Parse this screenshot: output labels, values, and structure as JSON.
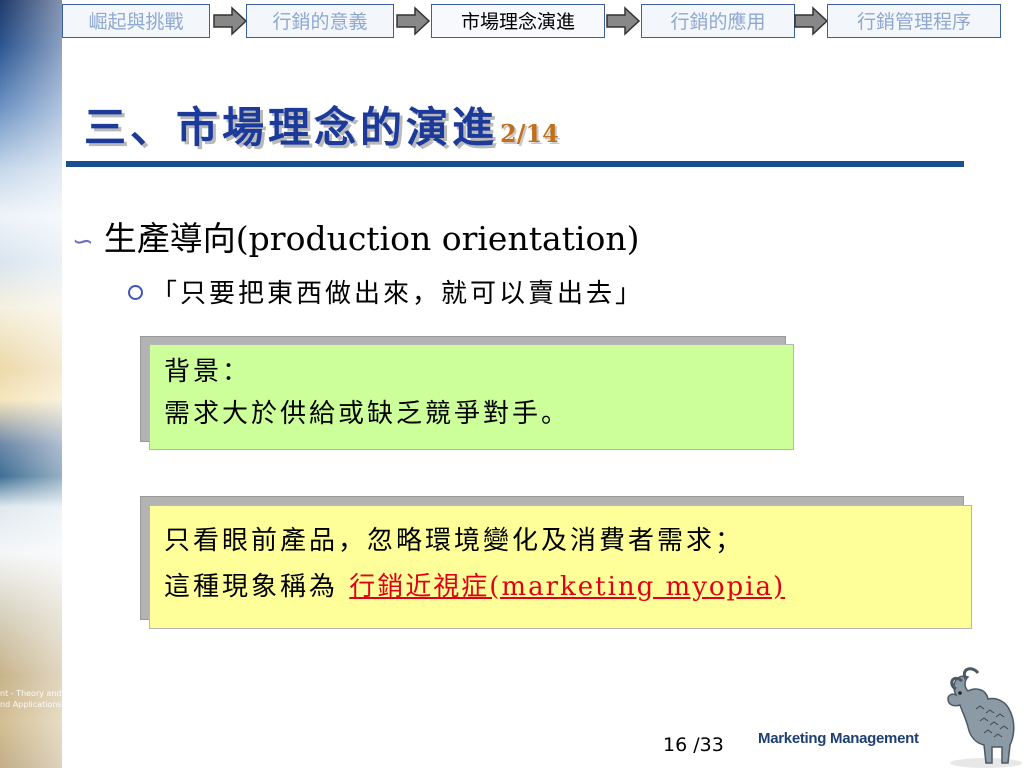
{
  "nav": {
    "items": [
      {
        "label": "崛起與挑戰",
        "active": false
      },
      {
        "label": "行銷的意義",
        "active": false
      },
      {
        "label": "市場理念演進",
        "active": true
      },
      {
        "label": "行銷的應用",
        "active": false
      },
      {
        "label": "行銷管理程序",
        "active": false
      }
    ]
  },
  "side_strip": {
    "caption_line1": "nt - Theory and A",
    "caption_line2": "nd Applications"
  },
  "title": {
    "text": "三、市場理念的演進",
    "page_indicator": "2/14"
  },
  "bullets": {
    "level1_marker": "∽",
    "level1_text": "生產導向(production orientation)",
    "level2_text": "「只要把東西做出來，就可以賣出去」"
  },
  "box_green": {
    "line1": "背景：",
    "line2": "需求大於供給或缺乏競爭對手。"
  },
  "box_yellow": {
    "line1": "只看眼前產品，忽略環境變化及消費者需求；",
    "line2_prefix": "這種現象稱為 ",
    "line2_highlight": "行銷近視症(marketing myopia)"
  },
  "footer": {
    "page_number": "16 /33",
    "brand": "Marketing Management"
  },
  "colors": {
    "title": "#1b3a9a",
    "page_indicator": "#c0701a",
    "rule": "#1b4f93",
    "green_box": "#ccff99",
    "yellow_box": "#ffff99",
    "highlight": "#e0001a"
  }
}
